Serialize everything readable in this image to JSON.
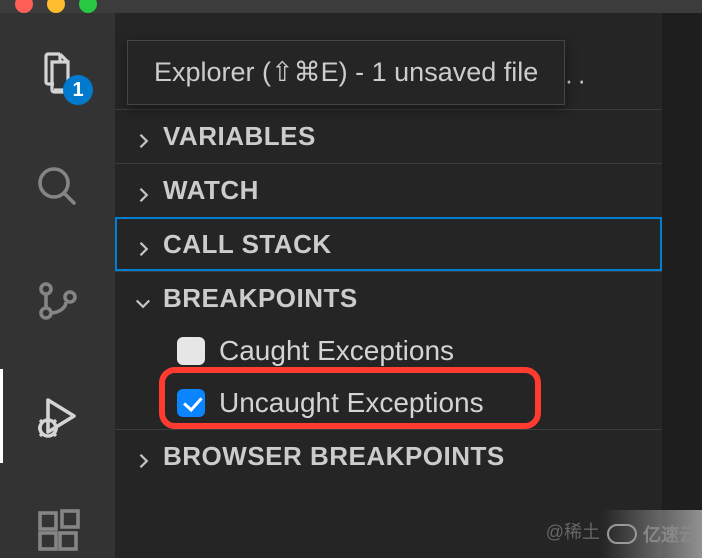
{
  "titlebar": {
    "traffic": [
      "close",
      "minimize",
      "zoom"
    ]
  },
  "activity_bar": {
    "explorer_badge": "1",
    "items": [
      {
        "name": "explorer",
        "active": false,
        "bright": true
      },
      {
        "name": "search",
        "active": false,
        "bright": false
      },
      {
        "name": "source-control",
        "active": false,
        "bright": false
      },
      {
        "name": "run-debug",
        "active": true,
        "bright": true
      },
      {
        "name": "extensions",
        "active": false,
        "bright": false
      }
    ]
  },
  "tooltip": {
    "text": "Explorer (⇧⌘E) - 1 unsaved file"
  },
  "debug_panel": {
    "more_label": "···",
    "sections": {
      "variables": {
        "label": "VARIABLES",
        "expanded": false
      },
      "watch": {
        "label": "WATCH",
        "expanded": false
      },
      "callstack": {
        "label": "CALL STACK",
        "expanded": false,
        "selected": true
      },
      "breakpoints": {
        "label": "BREAKPOINTS",
        "expanded": true,
        "items": [
          {
            "label": "Caught Exceptions",
            "checked": false
          },
          {
            "label": "Uncaught Exceptions",
            "checked": true,
            "highlighted": true
          }
        ]
      },
      "browser_breakpoints": {
        "label": "BROWSER BREAKPOINTS",
        "expanded": false
      }
    }
  },
  "watermarks": {
    "cn": "@稀土",
    "logo": "亿速云"
  }
}
